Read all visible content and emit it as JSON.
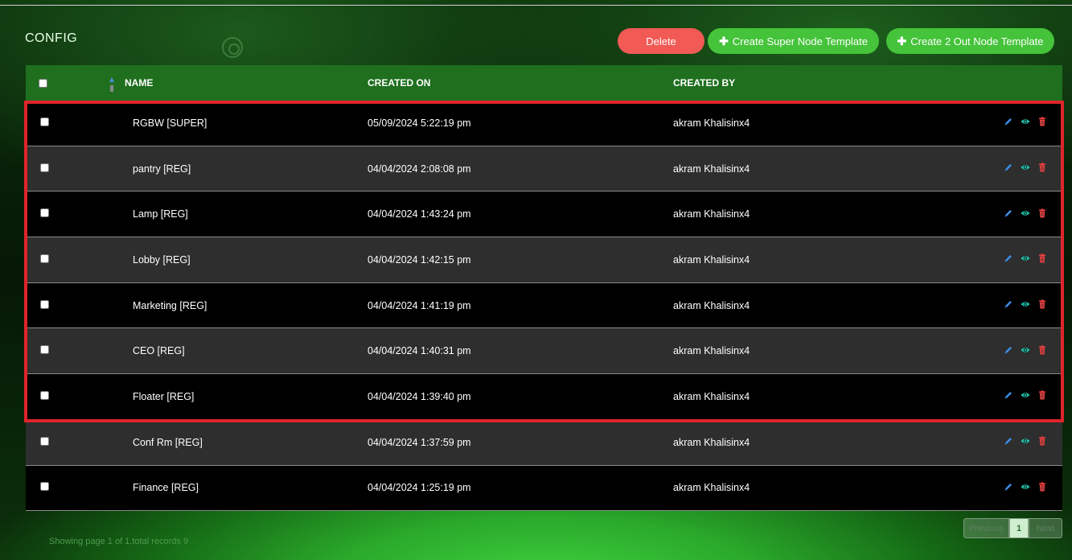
{
  "page": {
    "title": "CONFIG"
  },
  "toolbar": {
    "delete_label": "Delete",
    "create_super_label": "Create Super Node Template",
    "create_two_out_label": "Create 2 Out Node Template"
  },
  "table": {
    "columns": {
      "name": "NAME",
      "created_on": "CREATED ON",
      "created_by": "CREATED BY"
    },
    "rows": [
      {
        "name": "RGBW [SUPER]",
        "created_on": "05/09/2024 5:22:19 pm",
        "created_by": "akram Khalisinx4"
      },
      {
        "name": "pantry [REG]",
        "created_on": "04/04/2024 2:08:08 pm",
        "created_by": "akram Khalisinx4"
      },
      {
        "name": "Lamp [REG]",
        "created_on": "04/04/2024 1:43:24 pm",
        "created_by": "akram Khalisinx4"
      },
      {
        "name": "Lobby [REG]",
        "created_on": "04/04/2024 1:42:15 pm",
        "created_by": "akram Khalisinx4"
      },
      {
        "name": "Marketing [REG]",
        "created_on": "04/04/2024 1:41:19 pm",
        "created_by": "akram Khalisinx4"
      },
      {
        "name": "CEO [REG]",
        "created_on": "04/04/2024 1:40:31 pm",
        "created_by": "akram Khalisinx4"
      },
      {
        "name": "Floater [REG]",
        "created_on": "04/04/2024 1:39:40 pm",
        "created_by": "akram Khalisinx4"
      },
      {
        "name": "Conf Rm [REG]",
        "created_on": "04/04/2024 1:37:59 pm",
        "created_by": "akram Khalisinx4"
      },
      {
        "name": "Finance [REG]",
        "created_on": "04/04/2024 1:25:19 pm",
        "created_by": "akram Khalisinx4"
      }
    ],
    "row_actions": [
      "pencil-icon",
      "eye-icon",
      "trash-icon"
    ]
  },
  "footer": {
    "summary": "Showing page 1 of 1,total records 9"
  },
  "pagination": {
    "previous": "Previous",
    "current": "1",
    "next": "Next"
  },
  "colors": {
    "header_bg": "#1f6f1f",
    "delete": "#f15a55",
    "create": "#45c33a",
    "highlight": "#e0242c",
    "edit_icon": "#3a8ee6",
    "view_icon": "#1fc7b0",
    "delete_icon": "#f04040"
  }
}
